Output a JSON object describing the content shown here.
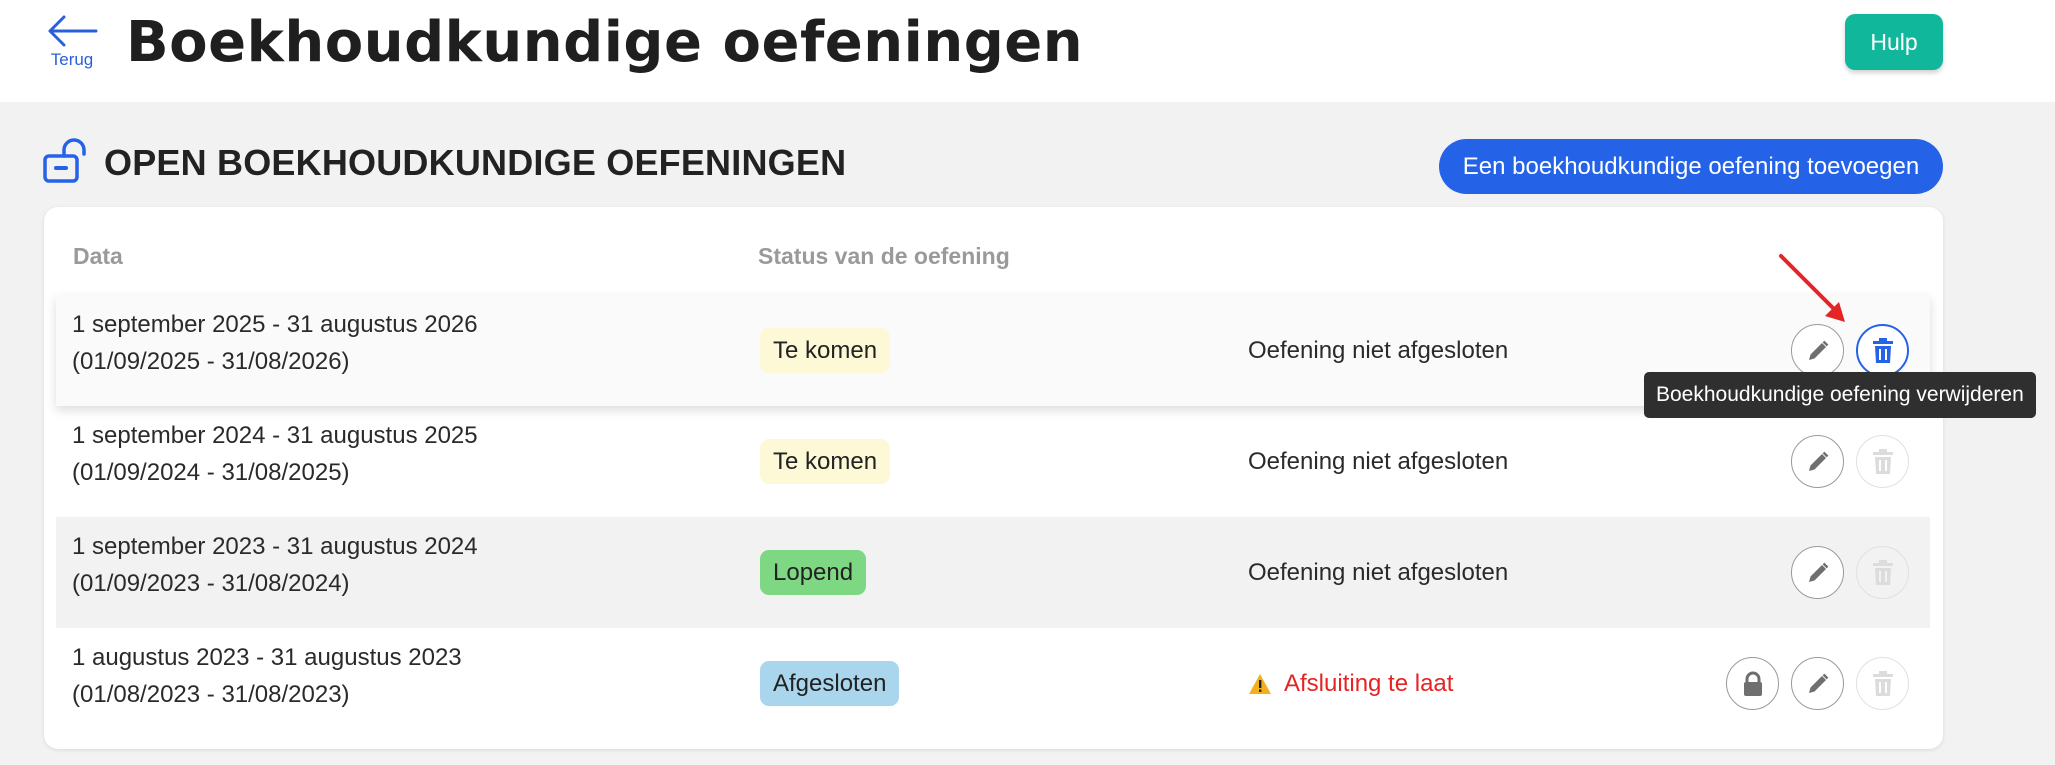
{
  "header": {
    "back_label": "Terug",
    "title": "Boekhoudkundige oefeningen",
    "help_label": "Hulp"
  },
  "section": {
    "title": "OPEN BOEKHOUDKUNDIGE OEFENINGEN",
    "add_button_label": "Een boekhoudkundige oefening toevoegen"
  },
  "table": {
    "columns": [
      "Data",
      "Status van de oefening"
    ],
    "rows": [
      {
        "date_main": "1 september 2025 - 31 augustus 2026",
        "date_sub": "(01/09/2025 - 31/08/2026)",
        "status_badge": "Te komen",
        "status_text": "Oefening niet afgesloten"
      },
      {
        "date_main": "1 september 2024 - 31 augustus 2025",
        "date_sub": "(01/09/2024 - 31/08/2025)",
        "status_badge": "Te komen",
        "status_text": "Oefening niet afgesloten"
      },
      {
        "date_main": "1 september 2023 - 31 augustus 2024",
        "date_sub": "(01/09/2023 - 31/08/2024)",
        "status_badge": "Lopend",
        "status_text": "Oefening niet afgesloten"
      },
      {
        "date_main": "1 augustus 2023 - 31 augustus 2023",
        "date_sub": "(01/08/2023 - 31/08/2023)",
        "status_badge": "Afgesloten",
        "status_text": "Afsluiting te laat"
      }
    ]
  },
  "tooltip": {
    "text": "Boekhoudkundige oefening verwijderen"
  },
  "colors": {
    "primary": "#2462e8",
    "help": "#10b79a",
    "badge_upcoming": "#fdf9d6",
    "badge_running": "#7ed783",
    "badge_closed": "#a9d6ec",
    "warning": "#e52424",
    "annotation_arrow": "#e52424"
  },
  "icons": {
    "back": "arrow-left-icon",
    "section": "unlock-icon",
    "edit": "pencil-icon",
    "delete": "trash-icon",
    "lock": "lock-icon",
    "warning": "warning-icon"
  }
}
